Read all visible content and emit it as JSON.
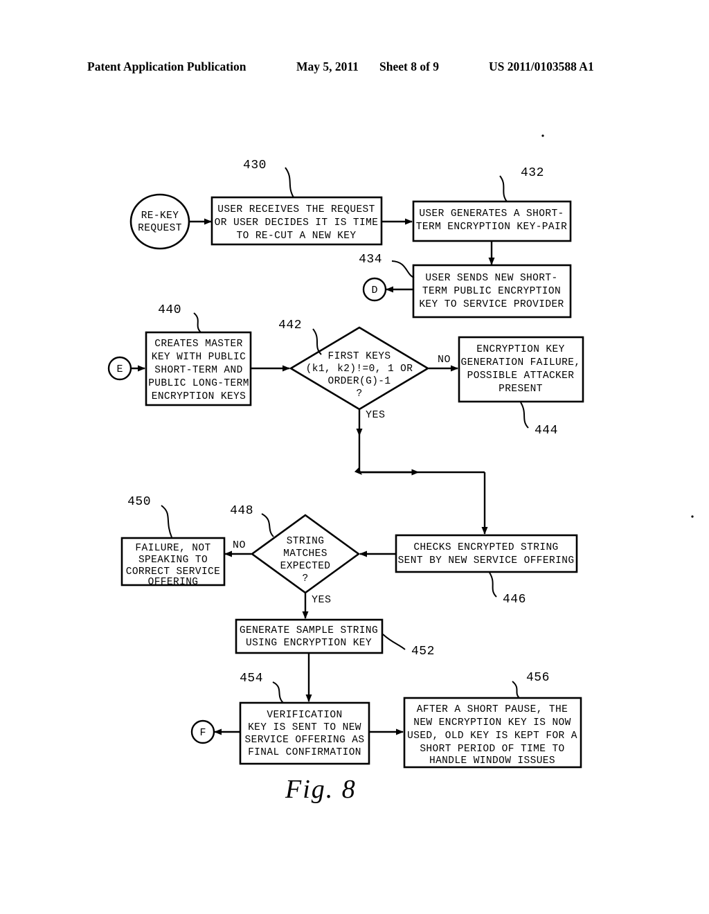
{
  "header": {
    "publication": "Patent Application Publication",
    "date": "May 5, 2011",
    "sheet": "Sheet 8 of 9",
    "number": "US 2011/0103588 A1"
  },
  "figure": {
    "caption": "Fig. 8"
  },
  "nodes": {
    "start": {
      "ref": "",
      "shape": "ellipse",
      "lines": [
        "RE-KEY",
        "REQUEST"
      ]
    },
    "n430": {
      "ref": "430",
      "shape": "process",
      "lines": [
        "USER RECEIVES THE REQUEST",
        "OR USER DECIDES IT IS TIME",
        "TO RE-CUT A NEW KEY"
      ]
    },
    "n432": {
      "ref": "432",
      "shape": "process",
      "lines": [
        "USER GENERATES A SHORT-",
        "TERM ENCRYPTION KEY-PAIR"
      ]
    },
    "n434": {
      "ref": "434",
      "shape": "process",
      "lines": [
        "USER SENDS NEW SHORT-",
        "TERM PUBLIC ENCRYPTION",
        "KEY TO SERVICE PROVIDER"
      ]
    },
    "n440": {
      "ref": "440",
      "shape": "process",
      "lines": [
        "CREATES MASTER",
        "KEY WITH PUBLIC",
        "SHORT-TERM AND",
        "PUBLIC LONG-TERM",
        "ENCRYPTION KEYS"
      ]
    },
    "n442": {
      "ref": "442",
      "shape": "decision",
      "lines": [
        "FIRST KEYS",
        "(k1, k2)!=0, 1 OR",
        "ORDER(G)-1",
        "?"
      ]
    },
    "n444": {
      "ref": "444",
      "shape": "process",
      "lines": [
        "ENCRYPTION KEY",
        "GENERATION FAILURE,",
        "POSSIBLE ATTACKER",
        "PRESENT"
      ]
    },
    "n446": {
      "ref": "446",
      "shape": "process",
      "lines": [
        "CHECKS ENCRYPTED STRING",
        "SENT BY NEW SERVICE OFFERING"
      ]
    },
    "n448": {
      "ref": "448",
      "shape": "decision",
      "lines": [
        "STRING",
        "MATCHES",
        "EXPECTED",
        "?"
      ]
    },
    "n450": {
      "ref": "450",
      "shape": "process",
      "lines": [
        "FAILURE, NOT",
        "SPEAKING TO",
        "CORRECT SERVICE",
        "OFFERING"
      ]
    },
    "n452": {
      "ref": "452",
      "shape": "process",
      "lines": [
        "GENERATE SAMPLE STRING",
        "USING ENCRYPTION KEY"
      ]
    },
    "n454": {
      "ref": "454",
      "shape": "process",
      "lines": [
        "VERIFICATION",
        "KEY IS SENT TO NEW",
        "SERVICE OFFERING AS",
        "FINAL CONFIRMATION"
      ]
    },
    "n456": {
      "ref": "456",
      "shape": "process",
      "lines": [
        "AFTER A SHORT PAUSE, THE",
        "NEW ENCRYPTION KEY IS NOW",
        "USED, OLD KEY IS KEPT FOR A",
        "SHORT PERIOD OF TIME TO",
        "HANDLE WINDOW ISSUES"
      ]
    }
  },
  "connectors": {
    "d": "D",
    "e": "E",
    "f": "F"
  },
  "branch_labels": {
    "no_442": "NO",
    "yes_442": "YES",
    "no_448": "NO",
    "yes_448": "YES"
  }
}
